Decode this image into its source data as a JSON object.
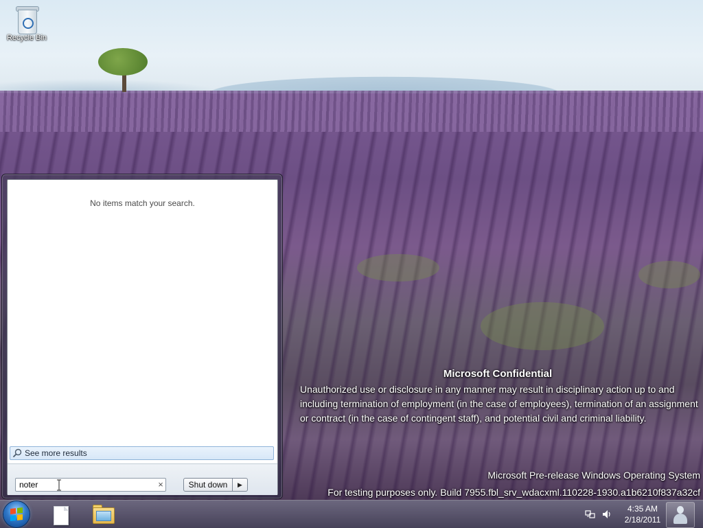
{
  "desktop": {
    "icons": [
      {
        "label": "Recycle Bin",
        "icon": "recycle-bin-icon"
      }
    ],
    "watermark": {
      "title": "Microsoft Confidential",
      "body": "Unauthorized use or disclosure in any manner may result in disciplinary action up to and including termination of employment (in the case of employees), termination of an assignment or contract (in the case of contingent staff), and potential civil and criminal liability.",
      "os_line": "Microsoft Pre-release Windows Operating System",
      "build_line": "For testing purposes only. Build 7955.fbl_srv_wdacxml.110228-1930.a1b6210f837a32cf"
    }
  },
  "start_menu": {
    "no_results_text": "No items match your search.",
    "see_more_results": "See more results",
    "search_value": "noter",
    "clear_glyph": "×",
    "shutdown_label": "Shut down",
    "shutdown_arrow": "▶"
  },
  "taskbar": {
    "pinned": [
      "document-icon",
      "windows-explorer-icon"
    ],
    "tray": {
      "icons": [
        "network-icon",
        "speaker-icon"
      ],
      "time": "4:35 AM",
      "date": "2/18/2011"
    },
    "flag_colors": [
      "#f25022",
      "#7fba00",
      "#00a4ef",
      "#ffb900"
    ]
  }
}
